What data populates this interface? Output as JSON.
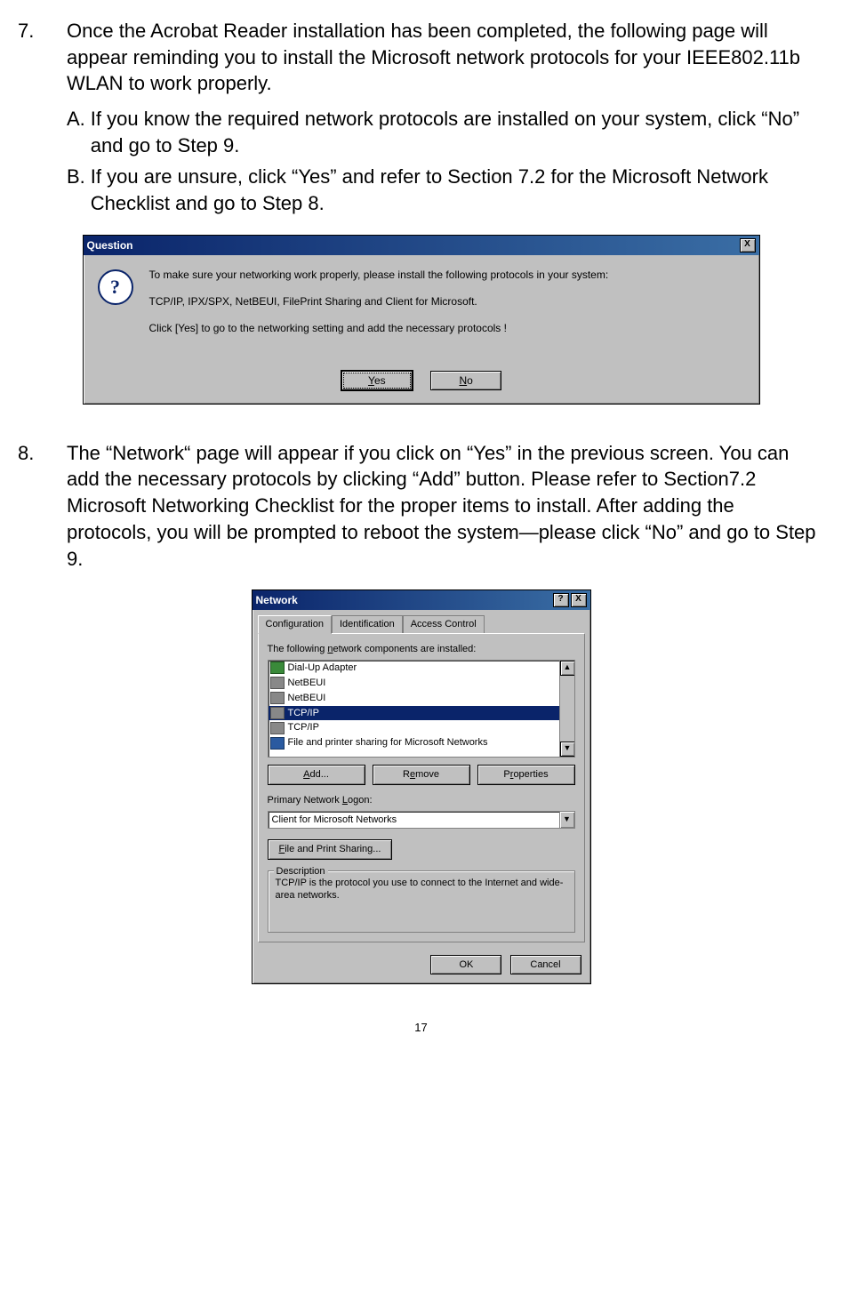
{
  "step7": {
    "num": "7.",
    "text": "Once the Acrobat Reader installation has been completed, the following page will appear reminding you to install the Microsoft network protocols for your IEEE802.11b WLAN to work properly.",
    "a_lead": "A.",
    "a_text": "If you know the required network protocols are installed on your system, click “No” and go to Step 9.",
    "b_lead": "B.",
    "b_text": "If you are unsure, click “Yes” and refer to Section 7.2 for the Microsoft Network Checklist and go to Step 8."
  },
  "question_dialog": {
    "title": "Question",
    "line1": "To make sure your networking work properly, please install the following protocols in your system:",
    "line2": "TCP/IP, IPX/SPX, NetBEUI, FilePrint Sharing and Client for Microsoft.",
    "line3": "Click [Yes] to go to the networking setting and add the necessary protocols !",
    "yes": "Yes",
    "no": "No",
    "close": "X"
  },
  "step8": {
    "num": "8.",
    "text": "The “Network“ page will appear if you click on “Yes” in the previous screen. You can add the necessary protocols by clicking “Add” button. Please refer to Section7.2 Microsoft Networking Checklist for the proper items to install.  After adding the protocols, you will be prompted to reboot the system—please click “No” and go to Step 9."
  },
  "network_dialog": {
    "title": "Network",
    "help": "?",
    "close": "X",
    "tabs": {
      "t1": "Configuration",
      "t2": "Identification",
      "t3": "Access Control"
    },
    "list_label_pre": "The following ",
    "list_label_u": "n",
    "list_label_post": "etwork components are installed:",
    "items": [
      {
        "icon": "adapter",
        "label": "Dial-Up Adapter",
        "sel": false
      },
      {
        "icon": "proto",
        "label": "NetBEUI",
        "sel": false
      },
      {
        "icon": "proto",
        "label": "NetBEUI",
        "sel": false
      },
      {
        "icon": "proto",
        "label": "TCP/IP",
        "sel": true
      },
      {
        "icon": "proto",
        "label": "TCP/IP",
        "sel": false
      },
      {
        "icon": "svc",
        "label": "File and printer sharing for Microsoft Networks",
        "sel": false
      }
    ],
    "add_u": "A",
    "add_rest": "dd...",
    "remove_pre": "R",
    "remove_u": "e",
    "remove_post": "move",
    "props_pre": "P",
    "props_u": "r",
    "props_post": "operties",
    "logon_label_pre": "Primary Network ",
    "logon_label_u": "L",
    "logon_label_post": "ogon:",
    "logon_value": "Client for Microsoft Networks",
    "fps_u": "F",
    "fps_rest": "ile and Print Sharing...",
    "desc_legend": "Description",
    "desc_text": "TCP/IP is the protocol you use to connect to the Internet and wide-area networks.",
    "ok": "OK",
    "cancel": "Cancel"
  },
  "page_number": "17"
}
